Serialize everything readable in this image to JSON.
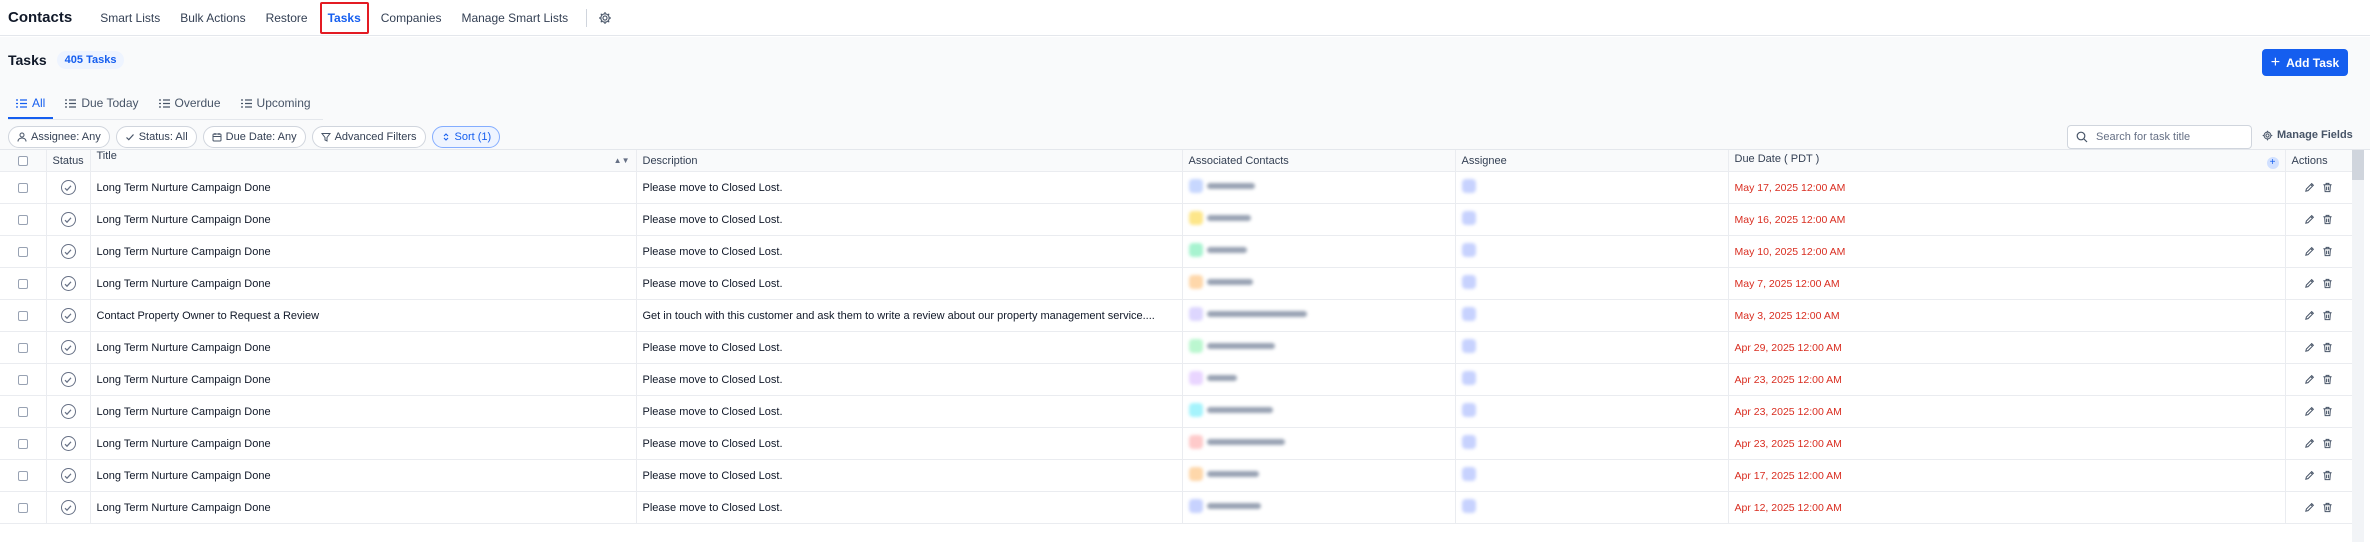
{
  "app_title": "Contacts",
  "nav": {
    "items": [
      {
        "label": "Smart Lists",
        "active": false
      },
      {
        "label": "Bulk Actions",
        "active": false
      },
      {
        "label": "Restore",
        "active": false
      },
      {
        "label": "Tasks",
        "active": true
      },
      {
        "label": "Companies",
        "active": false
      },
      {
        "label": "Manage Smart Lists",
        "active": false
      }
    ],
    "settings_icon": "gear-icon"
  },
  "page": {
    "title": "Tasks",
    "count_badge": "405 Tasks",
    "add_button": "Add Task"
  },
  "tabs": [
    {
      "label": "All",
      "active": true
    },
    {
      "label": "Due Today",
      "active": false
    },
    {
      "label": "Overdue",
      "active": false
    },
    {
      "label": "Upcoming",
      "active": false
    }
  ],
  "filters": {
    "assignee": "Assignee: Any",
    "status": "Status: All",
    "due_date": "Due Date: Any",
    "advanced": "Advanced Filters",
    "sort": "Sort (1)"
  },
  "search": {
    "placeholder": "Search for task title"
  },
  "manage_fields": "Manage Fields",
  "table": {
    "columns": [
      "Status",
      "Title",
      "Description",
      "Associated Contacts",
      "Assignee",
      "Due Date ( PDT )",
      "Actions"
    ],
    "rows": [
      {
        "title": "Long Term Nurture Campaign Done",
        "description": "Please move to Closed Lost.",
        "due": "May 17, 2025 12:00 AM"
      },
      {
        "title": "Long Term Nurture Campaign Done",
        "description": "Please move to Closed Lost.",
        "due": "May 16, 2025 12:00 AM"
      },
      {
        "title": "Long Term Nurture Campaign Done",
        "description": "Please move to Closed Lost.",
        "due": "May 10, 2025 12:00 AM"
      },
      {
        "title": "Long Term Nurture Campaign Done",
        "description": "Please move to Closed Lost.",
        "due": "May 7, 2025 12:00 AM"
      },
      {
        "title": "Contact Property Owner to Request a Review",
        "description": "Get in touch with this customer and ask them to write a review about our property management service....",
        "due": "May 3, 2025 12:00 AM"
      },
      {
        "title": "Long Term Nurture Campaign Done",
        "description": "Please move to Closed Lost.",
        "due": "Apr 29, 2025 12:00 AM"
      },
      {
        "title": "Long Term Nurture Campaign Done",
        "description": "Please move to Closed Lost.",
        "due": "Apr 23, 2025 12:00 AM"
      },
      {
        "title": "Long Term Nurture Campaign Done",
        "description": "Please move to Closed Lost.",
        "due": "Apr 23, 2025 12:00 AM"
      },
      {
        "title": "Long Term Nurture Campaign Done",
        "description": "Please move to Closed Lost.",
        "due": "Apr 23, 2025 12:00 AM"
      },
      {
        "title": "Long Term Nurture Campaign Done",
        "description": "Please move to Closed Lost.",
        "due": "Apr 17, 2025 12:00 AM"
      },
      {
        "title": "Long Term Nurture Campaign Done",
        "description": "Please move to Closed Lost.",
        "due": "Apr 12, 2025 12:00 AM"
      }
    ]
  },
  "colors": {
    "accent": "#155eef",
    "due_overdue": "#d92d20",
    "active_tab_outline": "#e31b23",
    "contact_avatars": [
      "#c7d7fe",
      "#fde68a",
      "#a7f3d0",
      "#fed7aa",
      "#ddd6fe",
      "#bbf7d0",
      "#e9d5ff",
      "#a5f3fc",
      "#fecaca",
      "#fed7aa",
      "#c7d2fe"
    ]
  }
}
